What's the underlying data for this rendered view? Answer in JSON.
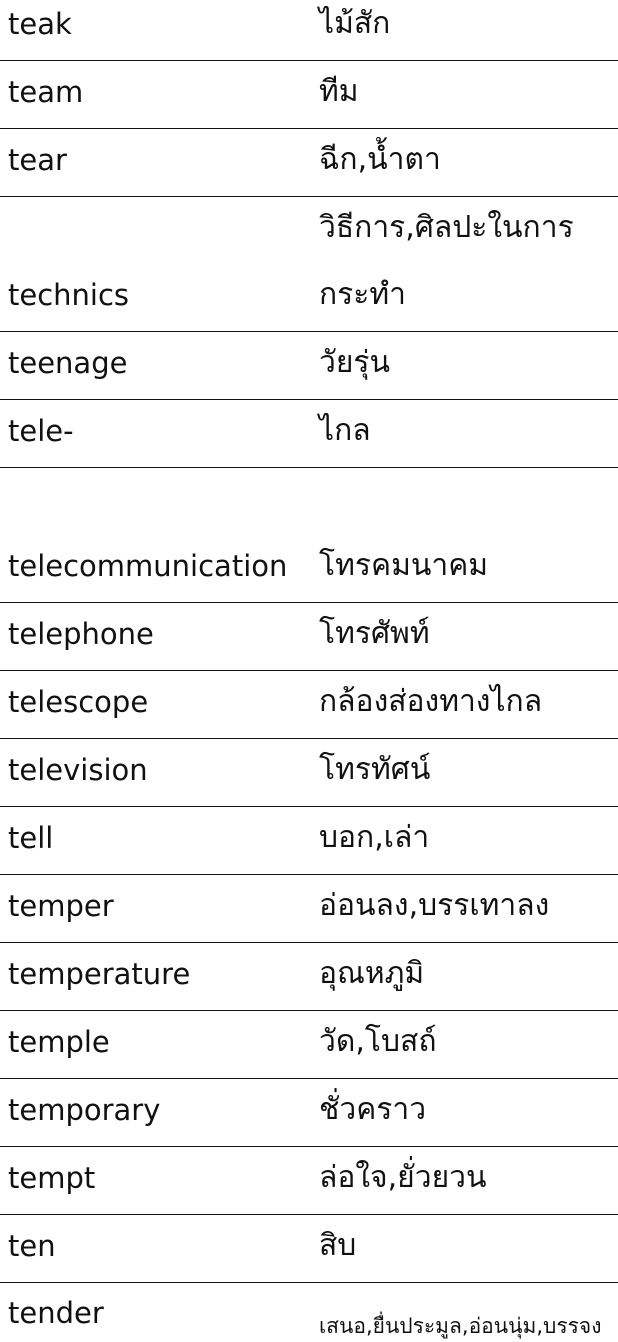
{
  "entries": [
    {
      "english": "teak",
      "thai": "ไม้สัก"
    },
    {
      "english": "team",
      "thai": "ทีม"
    },
    {
      "english": "tear",
      "thai": "ฉีก,น้ำตา"
    },
    {
      "english": "technics",
      "thai": [
        "วิธีการ,ศิลปะในการ",
        "กระทำ"
      ]
    },
    {
      "english": "teenage",
      "thai": "วัยรุ่น"
    },
    {
      "english": "tele-",
      "thai": "ไกล"
    },
    {
      "english": "",
      "thai": ""
    },
    {
      "english": "telecommunication",
      "thai": "โทรคมนาคม"
    },
    {
      "english": "telephone",
      "thai": "โทรศัพท์"
    },
    {
      "english": "telescope",
      "thai": "กล้องส่องทางไกล"
    },
    {
      "english": "television",
      "thai": "โทรทัศน์"
    },
    {
      "english": "tell",
      "thai": "บอก,เล่า"
    },
    {
      "english": "temper",
      "thai": "อ่อนลง,บรรเทาลง"
    },
    {
      "english": "temperature",
      "thai": "อุณหภูมิ"
    },
    {
      "english": "temple",
      "thai": "วัด,โบสถ์"
    },
    {
      "english": "temporary",
      "thai": "ชั่วคราว"
    },
    {
      "english": "tempt",
      "thai": "ล่อใจ,ยั่วยวน"
    },
    {
      "english": "ten",
      "thai": "สิบ"
    },
    {
      "english": "tender",
      "thai": "เสนอ,ยื่นประมูล,อ่อนนุ่ม,บรรจง"
    }
  ]
}
